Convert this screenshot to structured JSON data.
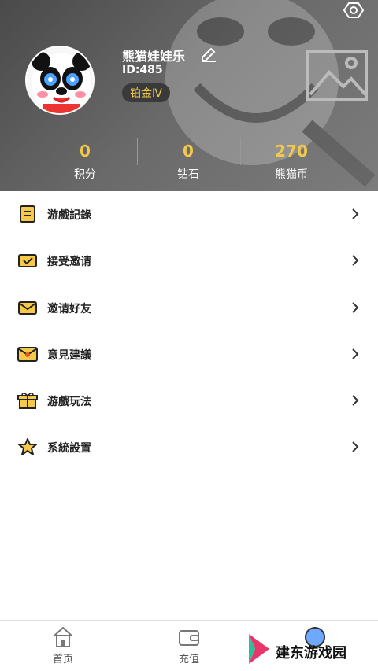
{
  "profile": {
    "username": "熊猫娃娃乐",
    "id_text": "ID:485",
    "badge": "铂金Ⅳ"
  },
  "stats": [
    {
      "value": "0",
      "label": "积分"
    },
    {
      "value": "0",
      "label": "钻石"
    },
    {
      "value": "270",
      "label": "熊猫币"
    }
  ],
  "menu": {
    "items": [
      {
        "label": "游戲記錄",
        "icon": "record-icon"
      },
      {
        "label": "接受邀请",
        "icon": "accept-invite-icon"
      },
      {
        "label": "邀请好友",
        "icon": "mail-icon"
      },
      {
        "label": "意見建議",
        "icon": "feedback-icon"
      },
      {
        "label": "游戲玩法",
        "icon": "gift-icon"
      },
      {
        "label": "系統設置",
        "icon": "star-settings-icon"
      }
    ]
  },
  "nav": {
    "home_label": "首页",
    "recharge_label": "充值"
  },
  "watermark": "建东游戏园",
  "colors": {
    "accent": "#f2c94c",
    "header_bg": "#5a5a5a",
    "menu_bg": "#ffffff",
    "icon_yellow": "#f7c948"
  }
}
